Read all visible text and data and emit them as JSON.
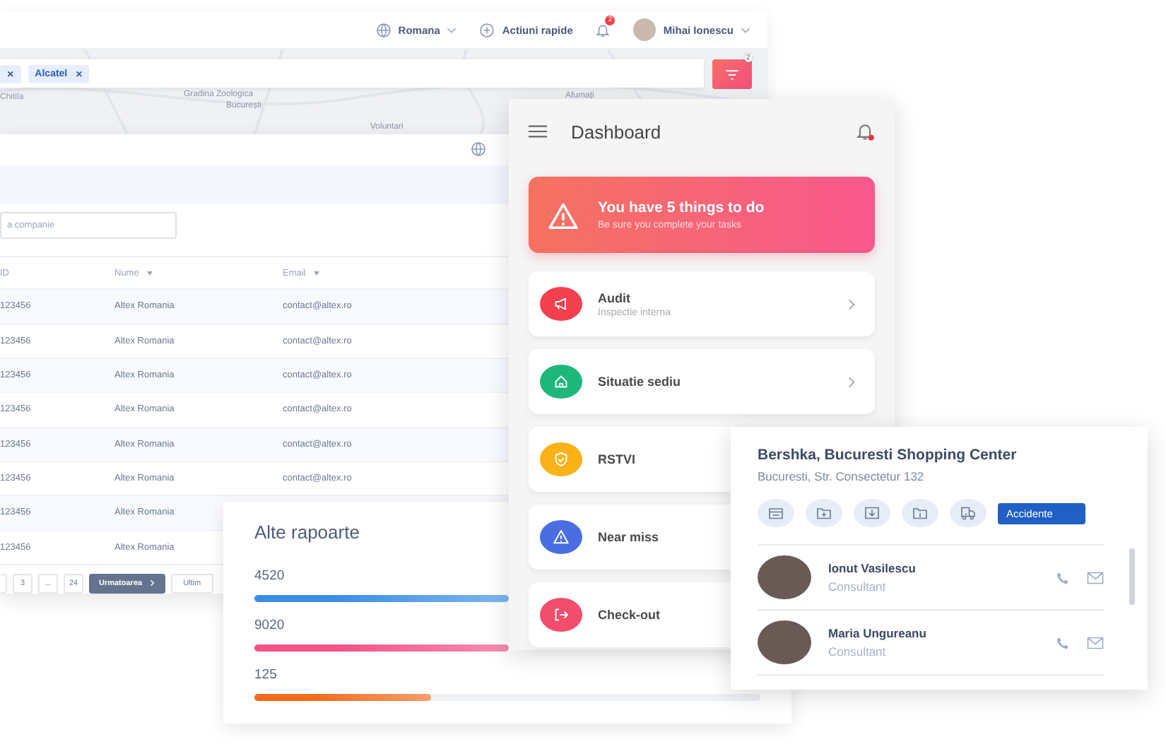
{
  "top_bar": {
    "language": "Romana",
    "quick_actions": "Actiuni rapide",
    "notification_count": "2",
    "user_name": "Mihai Ionescu"
  },
  "map": {
    "labels": [
      "Chitila",
      "Gradina Zoologica",
      "București",
      "Voluntari",
      "Afumați"
    ]
  },
  "filter_bar": {
    "chips": [
      {
        "remove": "×"
      },
      {
        "label": "Alcatel",
        "remove": "×"
      }
    ],
    "filter_count": "2"
  },
  "table_window": {
    "search_placeholder": "a companie",
    "columns": [
      {
        "label": "ID",
        "sortable": false
      },
      {
        "label": "Nume",
        "sortable": true
      },
      {
        "label": "Email",
        "sortable": true
      }
    ],
    "rows": [
      {
        "id": "123456",
        "name": "Altex Romania",
        "email": "contact@altex.ro"
      },
      {
        "id": "123456",
        "name": "Altex Romania",
        "email": "contact@altex.ro"
      },
      {
        "id": "123456",
        "name": "Altex Romania",
        "email": "contact@altex.ro"
      },
      {
        "id": "123456",
        "name": "Altex Romania",
        "email": "contact@altex.ro"
      },
      {
        "id": "123456",
        "name": "Altex Romania",
        "email": "contact@altex.ro"
      },
      {
        "id": "123456",
        "name": "Altex Romania",
        "email": "contact@altex.ro"
      },
      {
        "id": "123456",
        "name": "Altex Romania"
      },
      {
        "id": "123456",
        "name": "Altex Romania"
      }
    ],
    "pagination": {
      "pages": [
        {
          "label": "3",
          "selected": false
        },
        {
          "label": "...",
          "selected": false
        },
        {
          "label": "24",
          "selected": false
        }
      ],
      "next": "Urmatoarea",
      "last": "Ultim"
    }
  },
  "reports": {
    "title": "Alte rapoarte",
    "items": [
      {
        "value": "4520",
        "color": "#3a8ee6"
      },
      {
        "value": "9020",
        "color": "#f2508a"
      },
      {
        "value": "125",
        "level": 0.35,
        "color": "#f26a1b"
      }
    ]
  },
  "dashboard": {
    "title": "Dashboard",
    "has_notification": true,
    "alert": {
      "title": "You have 5 things to do",
      "subtitle": "Be sure you complete your tasks"
    },
    "items": [
      {
        "title": "Audit",
        "subtitle": "Inspectie interna",
        "kind": "megaphone",
        "color": "#f2404e"
      },
      {
        "title": "Situatie sediu",
        "kind": "home",
        "color": "#1db77c"
      },
      {
        "title": "RSTVI",
        "kind": "shield",
        "color": "#fbb217"
      },
      {
        "title": "Near miss",
        "kind": "warning",
        "color": "#4a6ee2"
      },
      {
        "title": "Check-out",
        "kind": "exit",
        "color": "#f24d6c"
      }
    ]
  },
  "store_card": {
    "title": "Bershka, Bucuresti Shopping Center",
    "address": "Bucuresti, Str. Consectetur 132",
    "actions": [
      {
        "kind": "archive"
      },
      {
        "kind": "folder-plus"
      },
      {
        "kind": "download"
      },
      {
        "kind": "folder-info"
      },
      {
        "kind": "truck",
        "tooltip": "Accidente"
      }
    ],
    "contacts": [
      {
        "name": "Ionut Vasilescu",
        "role": "Consultant"
      },
      {
        "name": "Maria Ungureanu",
        "role": "Consultant"
      }
    ]
  }
}
